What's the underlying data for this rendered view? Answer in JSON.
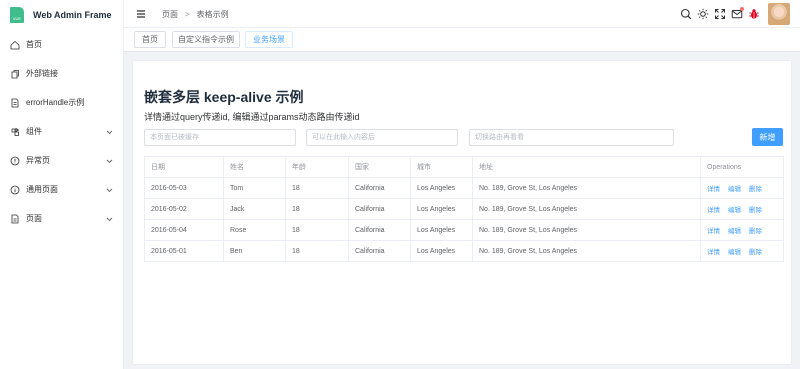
{
  "app": {
    "title": "Web Admin Frame",
    "logo_text": "VUE"
  },
  "sidebar": {
    "items": [
      {
        "label": "首页",
        "icon": "home-icon",
        "has_children": false
      },
      {
        "label": "外部链接",
        "icon": "external-link-icon",
        "has_children": false
      },
      {
        "label": "errorHandle示例",
        "icon": "document-icon",
        "has_children": false
      },
      {
        "label": "组件",
        "icon": "component-icon",
        "has_children": true
      },
      {
        "label": "异常页",
        "icon": "warning-icon",
        "has_children": true
      },
      {
        "label": "通用页面",
        "icon": "info-icon",
        "has_children": true
      },
      {
        "label": "页面",
        "icon": "page-icon",
        "has_children": true
      }
    ]
  },
  "header": {
    "breadcrumb": [
      "页面",
      "表格示例"
    ],
    "breadcrumb_separator": ">",
    "icons": [
      "search-icon",
      "theme-icon",
      "fullscreen-icon",
      "message-icon",
      "bug-icon"
    ],
    "message_badge_color": "#f56c6c",
    "bug_color": "#e6001f"
  },
  "tags": [
    {
      "label": "首页",
      "active": false
    },
    {
      "label": "自定义指令示例",
      "active": false
    },
    {
      "label": "业务场景",
      "active": true
    }
  ],
  "main": {
    "title": "嵌套多层 keep-alive 示例",
    "description": "详情通过query传递id, 编辑通过params动态路由传递id",
    "inputs": [
      {
        "placeholder": "本页面已被缓存",
        "value": ""
      },
      {
        "placeholder": "可以在此输入内容后",
        "value": ""
      },
      {
        "placeholder": "切换路由再看看",
        "value": ""
      }
    ],
    "add_button": "新增",
    "table": {
      "columns": [
        "日期",
        "姓名",
        "年龄",
        "国家",
        "城市",
        "地址",
        "Operations"
      ],
      "rows": [
        [
          "2016-05-03",
          "Tom",
          "18",
          "California",
          "Los Angeles",
          "No. 189, Grove St, Los Angeles"
        ],
        [
          "2016-05-02",
          "Jack",
          "18",
          "California",
          "Los Angeles",
          "No. 189, Grove St, Los Angeles"
        ],
        [
          "2016-05-04",
          "Rose",
          "18",
          "California",
          "Los Angeles",
          "No. 189, Grove St, Los Angeles"
        ],
        [
          "2016-05-01",
          "Ben",
          "18",
          "California",
          "Los Angeles",
          "No. 189, Grove St, Los Angeles"
        ]
      ],
      "operations": [
        "详情",
        "编辑",
        "删除"
      ]
    }
  },
  "colors": {
    "primary": "#409eff",
    "logo_green": "#3fbd8b"
  }
}
